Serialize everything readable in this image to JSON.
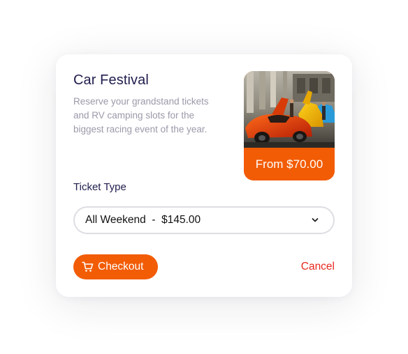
{
  "event": {
    "title": "Car Festival",
    "description": "Reserve your grandstand tickets and RV camping slots for the biggest racing event of the year.",
    "price_badge": "From $70.00"
  },
  "ticket": {
    "label": "Ticket Type",
    "selected": "All Weekend  -  $145.00"
  },
  "actions": {
    "checkout_label": "Checkout",
    "cancel_label": "Cancel"
  },
  "icons": {
    "cart": "cart-icon",
    "chevron": "chevron-down-icon"
  },
  "colors": {
    "accent": "#f25c05",
    "cancel": "#e8281e",
    "title": "#1f1d4d",
    "muted": "#9a9aaa"
  }
}
